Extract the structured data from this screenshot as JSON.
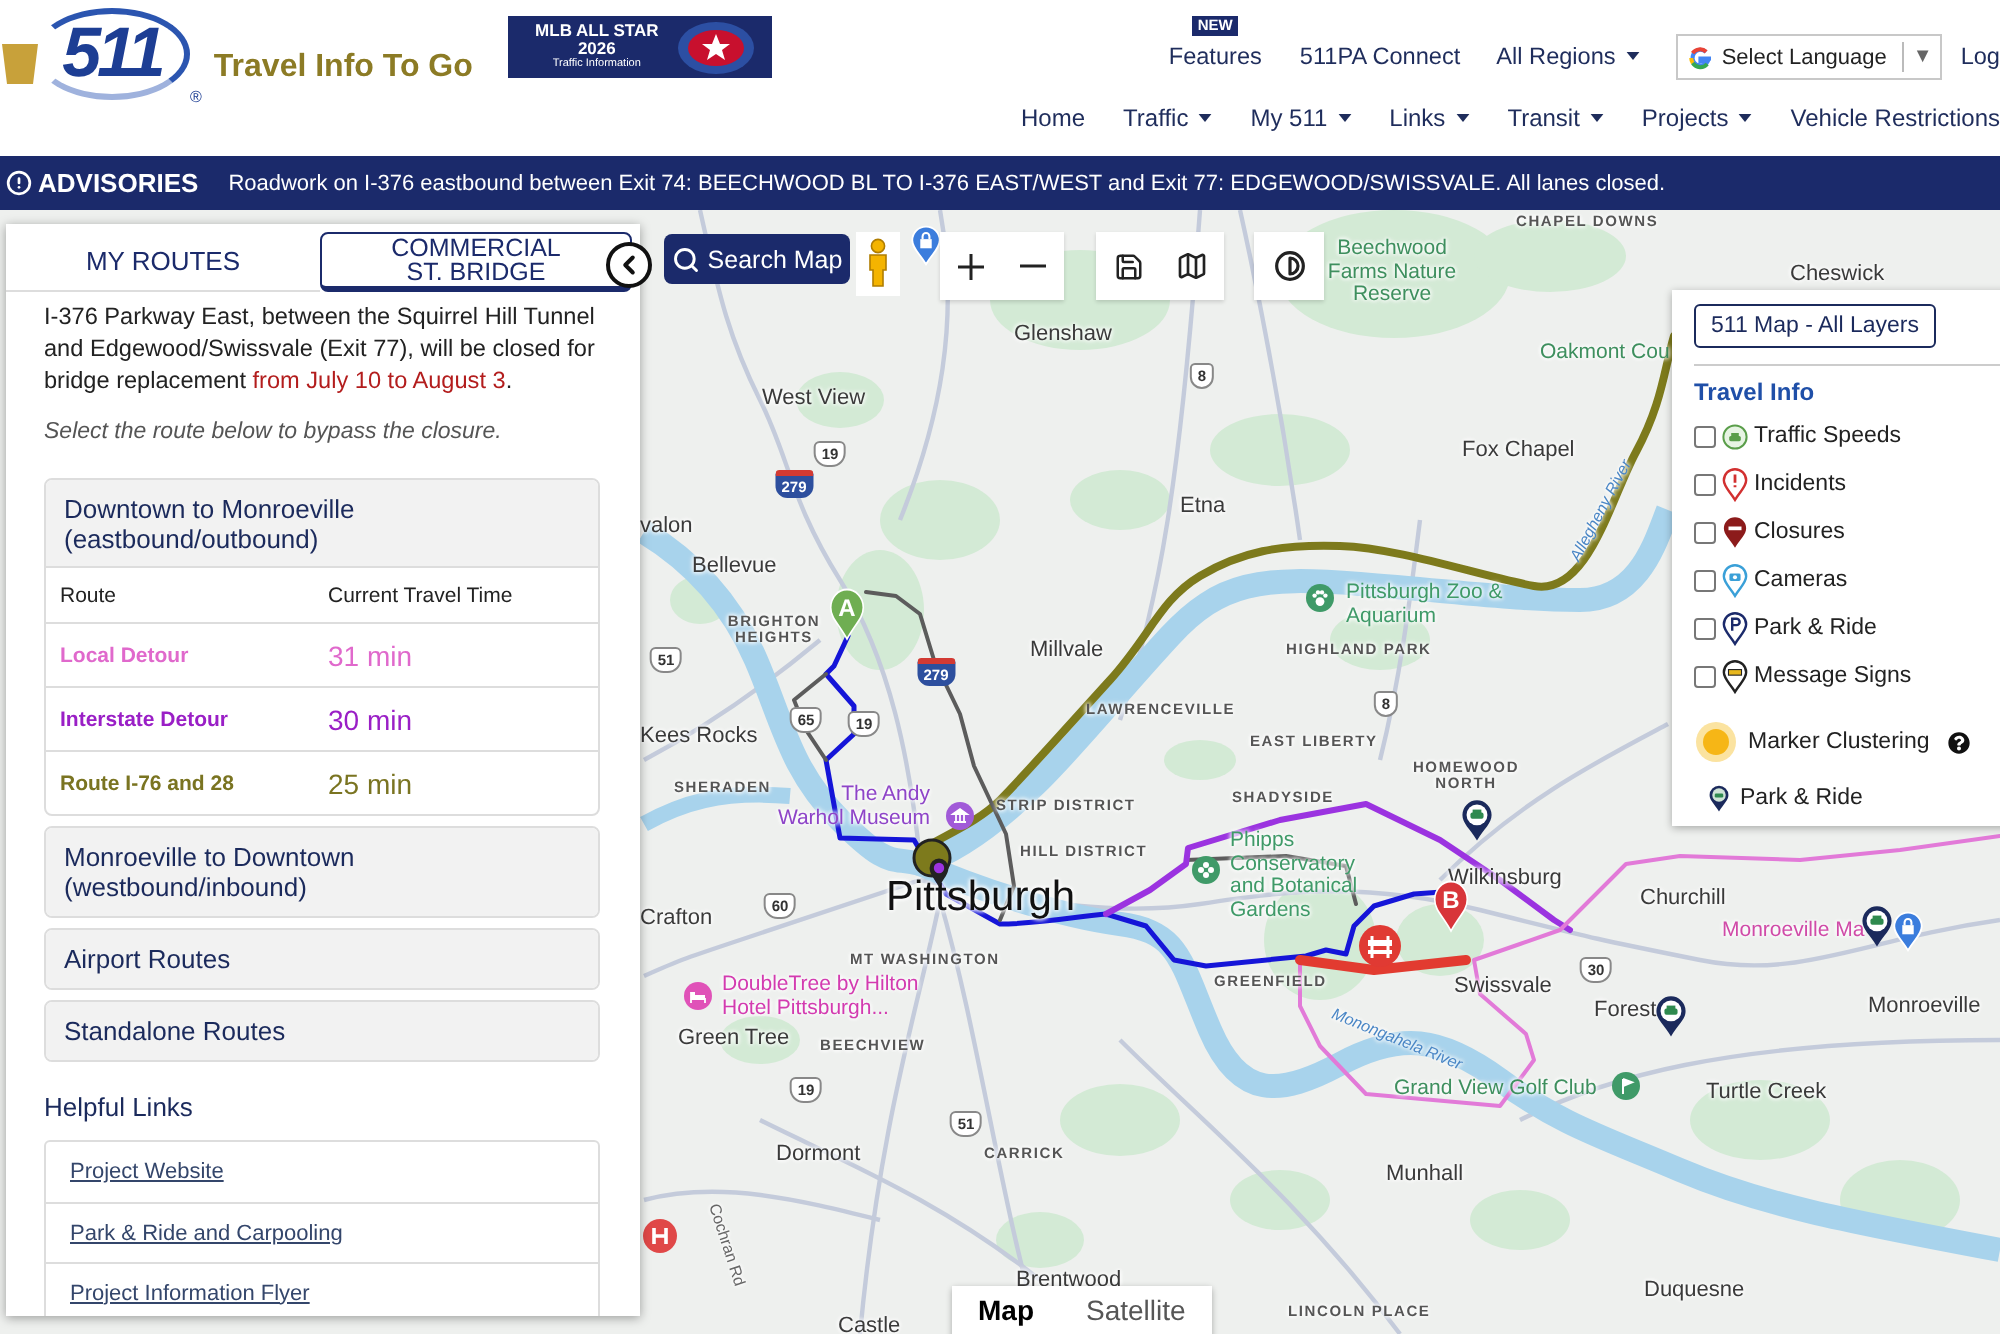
{
  "header": {
    "logo": {
      "text": "511",
      "mark": "®"
    },
    "tagline": "Travel Info To Go",
    "banner": {
      "title": "MLB ALL STAR",
      "year": "2026",
      "subtitle": "Traffic Information"
    },
    "top_links": [
      {
        "label": "Features",
        "badge": "NEW",
        "dropdown": false
      },
      {
        "label": "511PA Connect",
        "dropdown": false
      },
      {
        "label": "All Regions",
        "dropdown": true
      }
    ],
    "language": {
      "label": "Select Language",
      "arrow": "▼"
    },
    "account_link": "Log",
    "nav": [
      {
        "label": "Home",
        "dropdown": false
      },
      {
        "label": "Traffic",
        "dropdown": true
      },
      {
        "label": "My 511",
        "dropdown": true
      },
      {
        "label": "Links",
        "dropdown": true
      },
      {
        "label": "Transit",
        "dropdown": true
      },
      {
        "label": "Projects",
        "dropdown": true
      },
      {
        "label": "Vehicle Restrictions",
        "dropdown": false
      }
    ]
  },
  "advisory": {
    "label": "ADVISORIES",
    "message": "Roadwork on I-376 eastbound between Exit 74: BEECHWOOD BL TO I-376 EAST/WEST and Exit 77: EDGEWOOD/SWISSVALE. All lanes closed."
  },
  "panel": {
    "tabs": [
      {
        "label": "MY ROUTES",
        "selected": false
      },
      {
        "label": "COMMERCIAL ST. BRIDGE",
        "selected": true
      }
    ],
    "notice": {
      "text": "I-376 Parkway East, between the Squirrel Hill Tunnel and Edgewood/Swissvale (Exit 77), will be closed for bridge replacement ",
      "highlight": "from July 10 to August 3",
      "end": "."
    },
    "instruction": "Select the route below to bypass the closure.",
    "groups": [
      {
        "title": "Downtown to Monroeville (eastbound/outbound)",
        "expanded": true,
        "columns": [
          "Route",
          "Current Travel Time"
        ],
        "rows": [
          {
            "route": "Local Detour",
            "time": "31 min",
            "color": "#e069cc"
          },
          {
            "route": "Interstate Detour",
            "time": "30 min",
            "color": "#9a1fc6"
          },
          {
            "route": "Route I-76 and 28",
            "time": "25 min",
            "color": "#7a7421"
          }
        ]
      },
      {
        "title": "Monroeville to Downtown (westbound/inbound)",
        "expanded": false
      },
      {
        "title": "Airport Routes",
        "expanded": false
      },
      {
        "title": "Standalone Routes",
        "expanded": false
      }
    ],
    "links_title": "Helpful Links",
    "links": [
      "Project Website",
      "Park & Ride and Carpooling",
      "Project Information Flyer"
    ]
  },
  "map": {
    "search_button": "Search Map",
    "layers": {
      "button": "511 Map - All Layers",
      "section": "Travel Info",
      "items": [
        {
          "label": "Traffic Speeds",
          "kind": "speed",
          "checked": false
        },
        {
          "label": "Incidents",
          "kind": "incident",
          "checked": false
        },
        {
          "label": "Closures",
          "kind": "closure",
          "checked": false
        },
        {
          "label": "Cameras",
          "kind": "camera",
          "checked": false
        },
        {
          "label": "Park & Ride",
          "kind": "park",
          "checked": false
        },
        {
          "label": "Message Signs",
          "kind": "sign",
          "checked": false
        }
      ],
      "clustering": "Marker Clustering",
      "legend": "Park & Ride"
    },
    "view_toggle": [
      {
        "label": "Map",
        "selected": true
      },
      {
        "label": "Satellite",
        "selected": false
      }
    ],
    "routes": [
      {
        "color": "#7d7a1c"
      },
      {
        "color": "#1515d8"
      },
      {
        "color": "#5c5c5c"
      },
      {
        "color": "#9b33e0"
      },
      {
        "color": "#e27ad8"
      },
      {
        "color": "#e23b30"
      }
    ],
    "markers": [
      {
        "label": "A",
        "color": "#6fae52"
      },
      {
        "label": "B",
        "color": "#d8353a"
      }
    ],
    "labels": [
      {
        "text": "CHAPEL DOWNS",
        "kind": "district"
      },
      {
        "text": "Beechwood Farms Nature Reserve",
        "kind": "poi",
        "color": "#3e8f5e"
      },
      {
        "text": "Cheswick",
        "kind": "place"
      },
      {
        "text": "Glenshaw",
        "kind": "place"
      },
      {
        "text": "Oakmont Cou",
        "kind": "poi",
        "color": "#3e8f5e"
      },
      {
        "text": "West View",
        "kind": "place"
      },
      {
        "text": "Fox Chapel",
        "kind": "place"
      },
      {
        "text": "Etna",
        "kind": "place"
      },
      {
        "text": "valon",
        "kind": "place"
      },
      {
        "text": "Bellevue",
        "kind": "place"
      },
      {
        "text": "BRIGHTON HEIGHTS",
        "kind": "district"
      },
      {
        "text": "Millvale",
        "kind": "place"
      },
      {
        "text": "Pittsburgh Zoo & Aquarium",
        "kind": "poi",
        "color": "#3f9a68"
      },
      {
        "text": "HIGHLAND PARK",
        "kind": "district"
      },
      {
        "text": "LAWRENCEVILLE",
        "kind": "district"
      },
      {
        "text": "Kees Rocks",
        "kind": "place"
      },
      {
        "text": "EAST LIBERTY",
        "kind": "district"
      },
      {
        "text": "SHERADEN",
        "kind": "district"
      },
      {
        "text": "HOMEWOOD NORTH",
        "kind": "district"
      },
      {
        "text": "The Andy Warhol Museum",
        "kind": "poi",
        "color": "#8e44c8"
      },
      {
        "text": "STRIP DISTRICT",
        "kind": "district"
      },
      {
        "text": "SHADYSIDE",
        "kind": "district"
      },
      {
        "text": "Phipps Conservatory and Botanical Gardens",
        "kind": "poi",
        "color": "#3f9a68"
      },
      {
        "text": "HILL DISTRICT",
        "kind": "district"
      },
      {
        "text": "Pittsburgh",
        "kind": "city"
      },
      {
        "text": "Wilkinsburg",
        "kind": "place"
      },
      {
        "text": "Churchill",
        "kind": "place"
      },
      {
        "text": "Crafton",
        "kind": "place"
      },
      {
        "text": "Monroeville Ma",
        "kind": "poi",
        "color": "#d04ba8"
      },
      {
        "text": "MT WASHINGTON",
        "kind": "district"
      },
      {
        "text": "DoubleTree by Hilton Hotel Pittsburgh...",
        "kind": "poi",
        "color": "#d33bb0"
      },
      {
        "text": "GREENFIELD",
        "kind": "district"
      },
      {
        "text": "Swissvale",
        "kind": "place"
      },
      {
        "text": "Forest",
        "kind": "place"
      },
      {
        "text": "Monroeville",
        "kind": "place"
      },
      {
        "text": "Green Tree",
        "kind": "place"
      },
      {
        "text": "BEECHVIEW",
        "kind": "district"
      },
      {
        "text": "Monongahela River",
        "kind": "water"
      },
      {
        "text": "Allegheny River",
        "kind": "water"
      },
      {
        "text": "Grand View Golf Club",
        "kind": "poi",
        "color": "#3e8f5e"
      },
      {
        "text": "Turtle Creek",
        "kind": "place"
      },
      {
        "text": "Dormont",
        "kind": "place"
      },
      {
        "text": "CARRICK",
        "kind": "district"
      },
      {
        "text": "Munhall",
        "kind": "place"
      },
      {
        "text": "Cochran Rd",
        "kind": "road"
      },
      {
        "text": "Brentwood",
        "kind": "place"
      },
      {
        "text": "Duquesne",
        "kind": "place"
      },
      {
        "text": "LINCOLN PLACE",
        "kind": "district"
      },
      {
        "text": "Castle",
        "kind": "place"
      }
    ],
    "shields": [
      {
        "number": "279",
        "kind": "interstate"
      },
      {
        "number": "19",
        "kind": "us"
      },
      {
        "number": "8",
        "kind": "us"
      },
      {
        "number": "51",
        "kind": "us"
      },
      {
        "number": "279",
        "kind": "interstate"
      },
      {
        "number": "65",
        "kind": "us"
      },
      {
        "number": "19",
        "kind": "us"
      },
      {
        "number": "8",
        "kind": "us"
      },
      {
        "number": "60",
        "kind": "us"
      },
      {
        "number": "19",
        "kind": "us"
      },
      {
        "number": "51",
        "kind": "us"
      },
      {
        "number": "30",
        "kind": "us"
      }
    ]
  }
}
